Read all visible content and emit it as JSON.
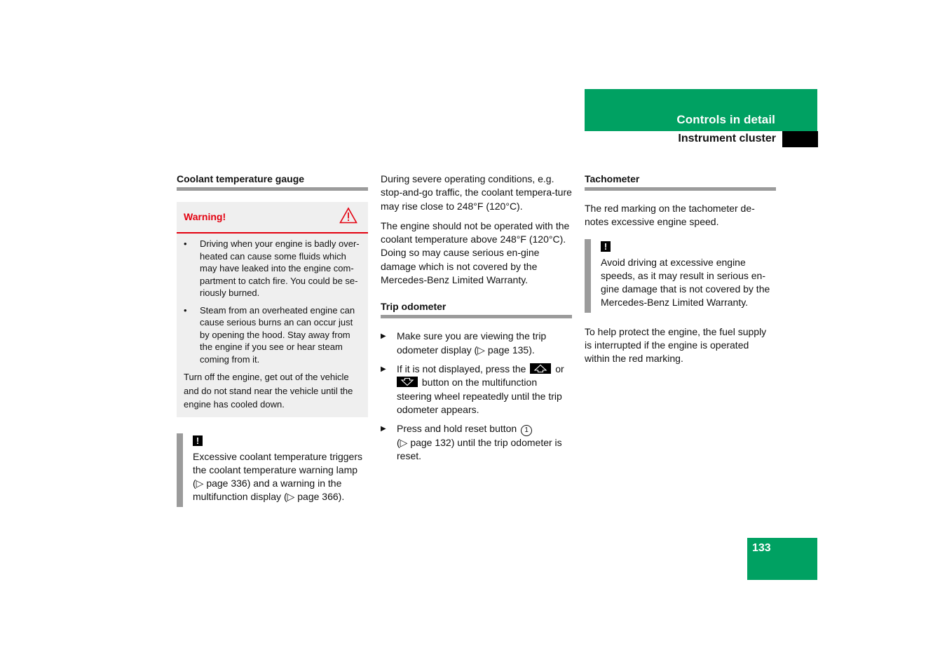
{
  "header": {
    "chapter": "Controls in detail",
    "section": "Instrument cluster",
    "accent_color": "#00a162"
  },
  "page_number": "133",
  "coolant": {
    "title": "Coolant temperature gauge",
    "warning": {
      "label": "Warning!",
      "icon": "warning-triangle-icon",
      "color": "#e3000f",
      "bullets": [
        "Driving when your engine is badly over-heated can cause some fluids which may have leaked into the engine com-partment to catch fire. You could be se-riously burned.",
        "Steam from an overheated engine can cause serious burns an can occur just by opening the hood. Stay away from the engine if you see or hear steam coming from it."
      ],
      "footer": "Turn off the engine, get out of the vehicle and do not stand near the vehicle until the engine has cooled down."
    },
    "note": {
      "icon": "!",
      "text": "Excessive coolant temperature triggers the coolant temperature warning lamp (▷ page 336) and a warning in the multifunction display (▷ page 366)."
    }
  },
  "middle": {
    "paragraphs": [
      "During severe operating conditions, e.g. stop-and-go traffic, the coolant tempera-ture may rise close to 248°F (120°C).",
      "The engine should not be operated with the coolant temperature above 248°F (120°C). Doing so may cause serious en-gine damage which is not covered by the Mercedes-Benz Limited Warranty."
    ]
  },
  "trip": {
    "title": "Trip odometer",
    "steps": [
      {
        "text": "Make sure you are viewing the trip odometer display (▷ page 135)."
      },
      {
        "before": "If it is not displayed, press the",
        "mid": "or",
        "after": "button on the multifunction steering wheel repeatedly until the trip odometer appears."
      },
      {
        "before": "Press and hold reset button",
        "circle": "1",
        "after": "(▷ page 132) until the trip odometer is reset."
      }
    ]
  },
  "tachometer": {
    "title": "Tachometer",
    "intro": "The red marking on the tachometer de-notes excessive engine speed.",
    "note": {
      "icon": "!",
      "text": "Avoid driving at excessive engine speeds, as it may result in serious en-gine damage that is not covered by the Mercedes-Benz Limited Warranty."
    },
    "outro": "To help protect the engine, the fuel supply is interrupted if the engine is operated within the red marking."
  }
}
